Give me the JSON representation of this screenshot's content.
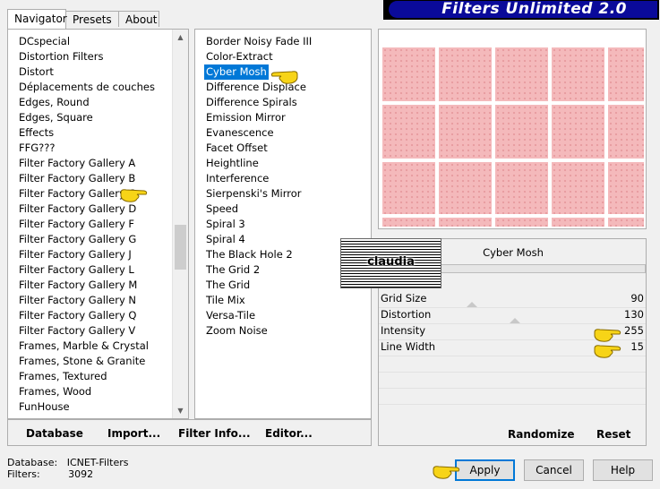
{
  "tabs": [
    {
      "label": "Navigator",
      "active": true
    },
    {
      "label": "Presets",
      "active": false
    },
    {
      "label": "About",
      "active": false
    }
  ],
  "banner_title": "Filters Unlimited 2.0",
  "categories": [
    "DCspecial",
    "Distortion Filters",
    "Distort",
    "Déplacements de couches",
    "Edges, Round",
    "Edges, Square",
    "Effects",
    "FFG???",
    "Filter Factory Gallery A",
    "Filter Factory Gallery B",
    "Filter Factory Gallery C",
    "Filter Factory Gallery D",
    "Filter Factory Gallery F",
    "Filter Factory Gallery G",
    "Filter Factory Gallery J",
    "Filter Factory Gallery L",
    "Filter Factory Gallery M",
    "Filter Factory Gallery N",
    "Filter Factory Gallery Q",
    "Filter Factory Gallery V",
    "Frames, Marble & Crystal",
    "Frames, Stone & Granite",
    "Frames, Textured",
    "Frames, Wood",
    "FunHouse"
  ],
  "filters": [
    "Border Noisy Fade III",
    "Color-Extract",
    "Cyber Mosh",
    "Difference Displace",
    "Difference Spirals",
    "Emission Mirror",
    "Evanescence",
    "Facet Offset",
    "Heightline",
    "Interference",
    "Sierpenski's Mirror",
    "Speed",
    "Spiral 3",
    "Spiral 4",
    "The Black Hole 2",
    "The Grid 2",
    "The Grid",
    "Tile Mix",
    "Versa-Tile",
    "Zoom Noise"
  ],
  "selected_filter_index": 2,
  "bottom_buttons": {
    "database": "Database",
    "import": "Import...",
    "filter_info": "Filter Info...",
    "editor": "Editor..."
  },
  "params_panel": {
    "filter_name": "Cyber Mosh",
    "params": [
      {
        "label": "Grid Size",
        "value": "90"
      },
      {
        "label": "Distortion",
        "value": "130"
      },
      {
        "label": "Intensity",
        "value": "255"
      },
      {
        "label": "Line Width",
        "value": "15"
      }
    ],
    "randomize": "Randomize",
    "reset": "Reset"
  },
  "watermark_text": "claudia",
  "status": {
    "database_label": "Database:",
    "database_value": "ICNET-Filters",
    "filters_label": "Filters:",
    "filters_value": "3092"
  },
  "dialog_buttons": {
    "apply": "Apply",
    "cancel": "Cancel",
    "help": "Help"
  },
  "colors": {
    "selection": "#0078d7",
    "banner": "#0a0a9a",
    "preview_tile": "#f4b9bb",
    "pointer_hand": "#f7d417"
  }
}
